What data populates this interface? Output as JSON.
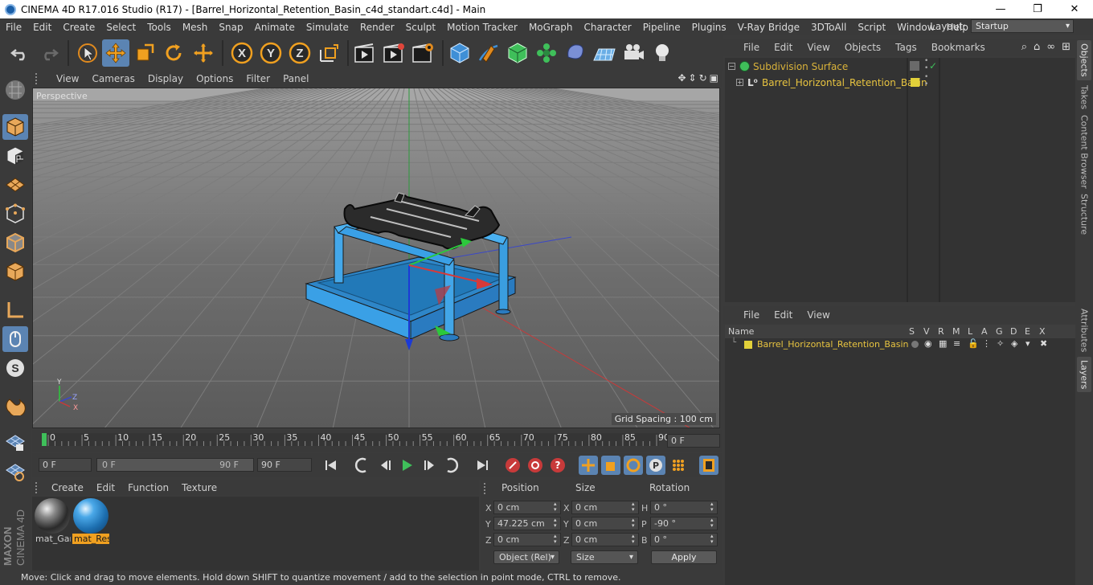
{
  "window": {
    "title": "CINEMA 4D R17.016 Studio (R17) - [Barrel_Horizontal_Retention_Basin_c4d_standart.c4d] - Main",
    "controls": [
      "—",
      "❐",
      "✕"
    ]
  },
  "menubar": {
    "items": [
      "File",
      "Edit",
      "Create",
      "Select",
      "Tools",
      "Mesh",
      "Snap",
      "Animate",
      "Simulate",
      "Render",
      "Sculpt",
      "Motion Tracker",
      "MoGraph",
      "Character",
      "Pipeline",
      "Plugins",
      "V-Ray Bridge",
      "3DToAll",
      "Script",
      "Window",
      "Help"
    ],
    "layout_label": "Layout:",
    "layout_value": "Startup"
  },
  "toolbar": {
    "axis_x": "X",
    "axis_y": "Y",
    "axis_z": "Z",
    "icons": [
      "undo-icon",
      "redo-icon",
      "select-icon",
      "move-icon",
      "scale-icon",
      "rotate-icon",
      "live-select-icon",
      "x-axis-icon",
      "y-axis-icon",
      "z-axis-icon",
      "coordinate-system-icon",
      "render-view-icon",
      "render-picture-viewer-icon",
      "render-settings-icon",
      "cube-icon",
      "pen-icon",
      "subdivision-icon",
      "mograph-cloner-icon",
      "deformer-icon",
      "floor-icon",
      "camera-icon",
      "light-icon"
    ]
  },
  "viewport": {
    "menu": [
      "View",
      "Cameras",
      "Display",
      "Options",
      "Filter",
      "Panel"
    ],
    "label": "Perspective",
    "grid_spacing": "Grid Spacing : 100 cm",
    "axis_labels": [
      "Y",
      "Z",
      "X"
    ]
  },
  "timeline": {
    "ticks": [
      "0",
      "5",
      "10",
      "15",
      "20",
      "25",
      "30",
      "35",
      "40",
      "45",
      "50",
      "55",
      "60",
      "65",
      "70",
      "75",
      "80",
      "85",
      "90"
    ],
    "current_frame": "0 F"
  },
  "playbar": {
    "start_field": "0 F",
    "range_start": "0 F",
    "range_end": "90 F",
    "end_field": "90 F"
  },
  "materials": {
    "menu": [
      "Create",
      "Edit",
      "Function",
      "Texture"
    ],
    "items": [
      {
        "name": "mat_Gar",
        "selected": false
      },
      {
        "name": "mat_Res",
        "selected": true
      }
    ]
  },
  "coordinates": {
    "headers": [
      "Position",
      "Size",
      "Rotation"
    ],
    "rows": [
      {
        "axis": "X",
        "pos": "0 cm",
        "size_axis": "X",
        "size": "0 cm",
        "rot_axis": "H",
        "rot": "0 °"
      },
      {
        "axis": "Y",
        "pos": "47.225 cm",
        "size_axis": "Y",
        "size": "0 cm",
        "rot_axis": "P",
        "rot": "-90 °"
      },
      {
        "axis": "Z",
        "pos": "0 cm",
        "size_axis": "Z",
        "size": "0 cm",
        "rot_axis": "B",
        "rot": "0 °"
      }
    ],
    "mode": "Object (Rel)",
    "size_mode": "Size",
    "apply": "Apply"
  },
  "status": "Move: Click and drag to move elements. Hold down SHIFT to quantize movement / add to the selection in point mode, CTRL to remove.",
  "brand": {
    "line1": "MAXON",
    "line2": "CINEMA 4D"
  },
  "object_manager": {
    "menu": [
      "File",
      "Edit",
      "View",
      "Objects",
      "Tags",
      "Bookmarks"
    ],
    "objects": [
      {
        "name": "Subdivision Surface",
        "color": "#d9b23a"
      },
      {
        "name": "Barrel_Horizontal_Retention_Basin",
        "color": "#e8c440"
      }
    ]
  },
  "layer_manager": {
    "menu": [
      "File",
      "Edit",
      "View"
    ],
    "columns": [
      "Name",
      "S",
      "V",
      "R",
      "M",
      "L",
      "A",
      "G",
      "D",
      "E",
      "X"
    ],
    "layers": [
      {
        "name": "Barrel_Horizontal_Retention_Basin",
        "color": "#e2d13a"
      }
    ]
  },
  "right_tabs": [
    "Objects",
    "Takes",
    "Content Browser",
    "Structure",
    "Attributes",
    "Layers"
  ]
}
